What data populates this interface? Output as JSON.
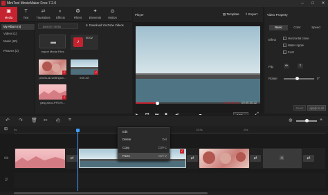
{
  "app": {
    "title": "MiniTool MovieMaker Free 7.2.0"
  },
  "toolbar": {
    "tabs": [
      {
        "label": "Media",
        "icon": "media-icon"
      },
      {
        "label": "Text",
        "icon": "text-icon"
      },
      {
        "label": "Transitions",
        "icon": "transitions-icon"
      },
      {
        "label": "Effects",
        "icon": "effects-icon"
      },
      {
        "label": "Filters",
        "icon": "filters-icon"
      },
      {
        "label": "Elements",
        "icon": "elements-icon"
      },
      {
        "label": "Motion",
        "icon": "motion-icon"
      }
    ]
  },
  "media": {
    "sidebar": [
      "My Album (4)",
      "Videos (1)",
      "Music (60)",
      "Pictures (2)"
    ],
    "search_placeholder": "Search media",
    "download_link": "Download YouTube Videos",
    "items": [
      {
        "caption": "Import Media Files"
      },
      {
        "caption": "",
        "duration": "00:02"
      },
      {
        "caption": "pexels-ali-wellington..."
      },
      {
        "caption": "river-4K"
      },
      {
        "caption": "yang-shuo-PF0VS..."
      }
    ]
  },
  "player": {
    "label": "Player",
    "template_btn": "Template",
    "export_btn": "Export",
    "time": "00:00:00.00",
    "total": "00:00:20.22",
    "ratio": "16:9"
  },
  "props": {
    "title": "Video Property",
    "tabs": [
      "Basic",
      "Color",
      "Speed"
    ],
    "effect_label": "Effect",
    "effects": [
      "Horizontal close",
      "Water ripple",
      "Fuzz"
    ],
    "flip_label": "Flip",
    "rotate_label": "Rotate",
    "rotate_value": "0°",
    "reset_btn": "Reset",
    "apply_btn": "Apply to all"
  },
  "ruler": {
    "marks": [
      "0s",
      "15.5s",
      "20s"
    ]
  },
  "context_menu": {
    "items": [
      {
        "label": "Edit",
        "key": ""
      },
      {
        "label": "Delete",
        "key": "Del"
      },
      {
        "label": "Copy",
        "key": "Ctrl+C"
      },
      {
        "label": "Paste",
        "key": "Ctrl+V"
      }
    ]
  }
}
